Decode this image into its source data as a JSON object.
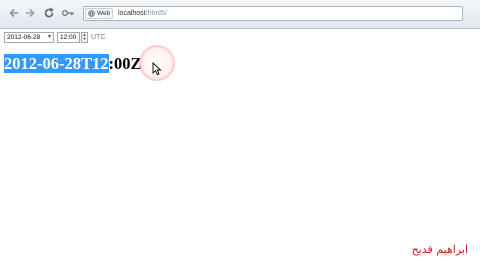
{
  "browser": {
    "site_label": "Web",
    "url_host": "localhost",
    "url_path": "/html5/"
  },
  "form": {
    "date_value": "2012-06-28",
    "time_value": "12:00",
    "timezone": "UTC"
  },
  "output": {
    "selected_text": "2012-06-28T12",
    "remaining_text": ":00Z"
  },
  "watermark": {
    "text": "ابراهيم قديح"
  },
  "colors": {
    "selection": "#3399ff",
    "watermark": "#cc1b1b"
  }
}
